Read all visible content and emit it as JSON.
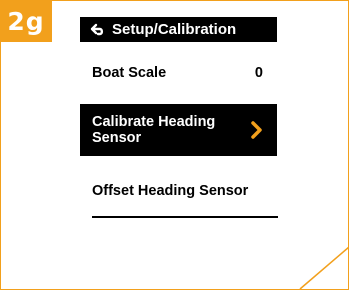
{
  "step_badge": "2g",
  "header": {
    "title": "Setup/Calibration",
    "back_icon": "return-arrow-icon"
  },
  "menu": {
    "boat_scale_label": "Boat Scale",
    "boat_scale_value": "0",
    "calibrate_label": "Calibrate Heading Sensor",
    "offset_label": "Offset Heading Sensor"
  },
  "colors": {
    "accent": "#f2a01c",
    "screen_bg": "#000000",
    "text": "#000000"
  }
}
